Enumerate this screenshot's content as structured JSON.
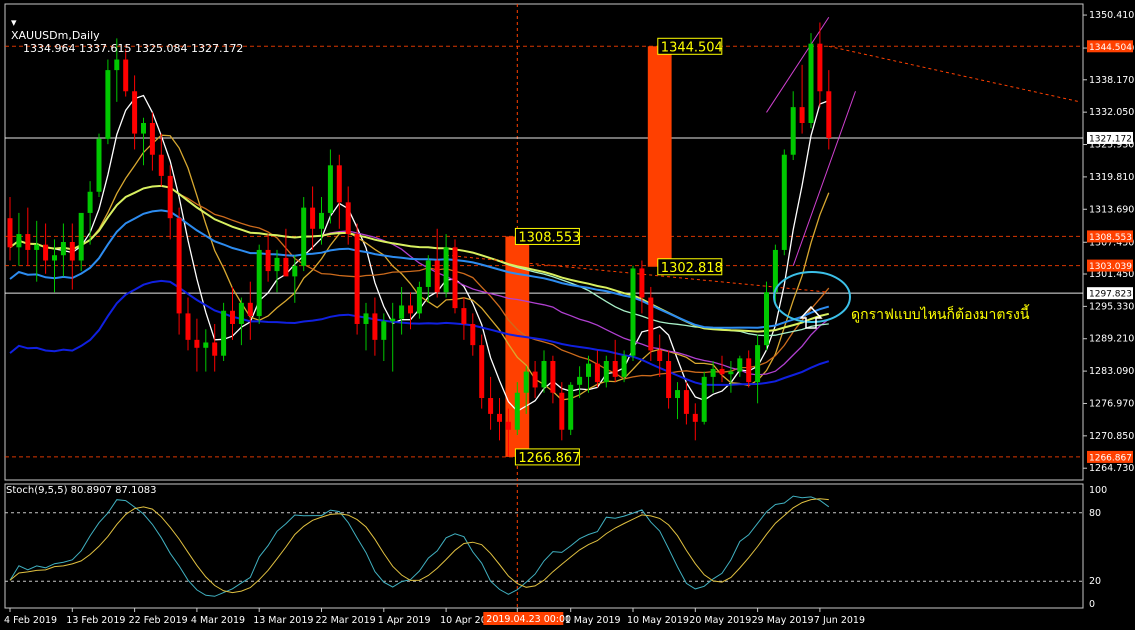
{
  "header": {
    "symbol": "XAUUSDm,Daily",
    "ohlc": "1334.964 1337.615 1325.084 1327.172"
  },
  "oscillator": {
    "label": "Stoch(9,5,5) 80.8907 87.1083",
    "levels": [
      0,
      20,
      80,
      100
    ],
    "level_labels": [
      "0",
      "20",
      "80",
      "100"
    ]
  },
  "annotation_text": "ดูกราฟแบบไหนก็ต้องมาตรงนี้",
  "colors": {
    "bull": "#00c800",
    "bear": "#ff0000",
    "highlight": "#ff4000",
    "text": "#ffffff",
    "label_bg_yellow": "#ffff00",
    "current_price_bg": "#ffffff",
    "ellipse": "#3cc0e8"
  },
  "chart_data": {
    "type": "candlestick",
    "price_range": [
      1262.5,
      1352.5
    ],
    "price_ticks": [
      1350.41,
      1344.17,
      1338.17,
      1332.05,
      1325.93,
      1319.81,
      1313.69,
      1307.45,
      1301.45,
      1295.33,
      1289.21,
      1283.09,
      1276.97,
      1270.85,
      1264.73
    ],
    "price_tick_labels": [
      "1350.410",
      "1344.170",
      "1338.170",
      "1332.050",
      "1325.930",
      "1319.810",
      "1313.690",
      "1307.450",
      "1301.450",
      "1295.330",
      "1289.210",
      "1283.090",
      "1276.970",
      "1270.850",
      "1264.730"
    ],
    "date_labels": [
      "4 Feb 2019",
      "13 Feb 2019",
      "22 Feb 2019",
      "4 Mar 2019",
      "13 Mar 2019",
      "22 Mar 2019",
      "1 Apr 2019",
      "10 Apr 2019",
      "2019.04.23 00:00",
      "1 May 2019",
      "10 May 2019",
      "20 May 2019",
      "29 May 2019",
      "7 Jun 2019"
    ],
    "date_label_index": [
      0,
      7,
      14,
      21,
      28,
      35,
      42,
      49,
      57,
      63,
      70,
      77,
      84,
      91
    ],
    "highlight_date_index": 57,
    "price_levels": [
      {
        "value": 1344.504,
        "label": "1344.504",
        "color": "#ff4000"
      },
      {
        "value": 1308.553,
        "label": "1308.553",
        "color": "#ff4000"
      },
      {
        "value": 1303.039,
        "label": "1303.039",
        "color": "#ff4000"
      },
      {
        "value": 1297.823,
        "label": "1297.823",
        "color": "#ffffff"
      },
      {
        "value": 1327.172,
        "label": "1327.172",
        "color": "#ffffff"
      },
      {
        "value": 1266.867,
        "label": "1266.867",
        "color": "#ff4000"
      }
    ],
    "boxes": [
      {
        "label": "1308.553",
        "index_from": 56,
        "index_to": 58,
        "high": 1308.553,
        "low": 1266.867,
        "label_at": "high"
      },
      {
        "label": "1266.867",
        "index_from": 56,
        "index_to": 58,
        "high": 1308.553,
        "low": 1266.867,
        "label_at": "low"
      },
      {
        "label": "1344.504",
        "index_from": 72,
        "index_to": 74,
        "high": 1344.504,
        "low": 1302.818,
        "label_at": "high"
      },
      {
        "label": "1302.818",
        "index_from": 72,
        "index_to": 74,
        "high": 1344.504,
        "low": 1302.818,
        "label_at": "low"
      }
    ],
    "candles": [
      [
        1312.0,
        1316.0,
        1304.0,
        1306.5
      ],
      [
        1306.5,
        1313.0,
        1303.0,
        1309.0
      ],
      [
        1309.0,
        1314.0,
        1303.0,
        1306.0
      ],
      [
        1306.0,
        1311.5,
        1300.0,
        1307.0
      ],
      [
        1307.0,
        1311.0,
        1301.5,
        1304.0
      ],
      [
        1304.0,
        1308.0,
        1298.0,
        1305.0
      ],
      [
        1305.0,
        1311.0,
        1301.0,
        1307.5
      ],
      [
        1307.5,
        1311.0,
        1298.5,
        1304.0
      ],
      [
        1304.0,
        1311.0,
        1302.0,
        1313.0
      ],
      [
        1313.0,
        1319.0,
        1307.0,
        1317.0
      ],
      [
        1317.0,
        1328.0,
        1316.0,
        1327.0
      ],
      [
        1327.0,
        1342.0,
        1326.0,
        1340.0
      ],
      [
        1340.0,
        1346.0,
        1334.0,
        1342.0
      ],
      [
        1342.0,
        1344.0,
        1335.0,
        1336.0
      ],
      [
        1336.0,
        1339.0,
        1325.0,
        1328.0
      ],
      [
        1328.0,
        1331.0,
        1322.0,
        1330.0
      ],
      [
        1330.0,
        1332.0,
        1321.0,
        1324.0
      ],
      [
        1324.0,
        1328.0,
        1318.0,
        1320.0
      ],
      [
        1320.0,
        1322.0,
        1308.0,
        1312.0
      ],
      [
        1312.0,
        1314.0,
        1290.0,
        1294.0
      ],
      [
        1294.0,
        1297.0,
        1287.0,
        1289.0
      ],
      [
        1289.0,
        1293.0,
        1283.0,
        1287.5
      ],
      [
        1287.5,
        1291.0,
        1283.0,
        1288.5
      ],
      [
        1288.5,
        1292.0,
        1283.0,
        1286.0
      ],
      [
        1286.0,
        1296.0,
        1285.0,
        1294.5
      ],
      [
        1294.5,
        1299.0,
        1289.0,
        1292.0
      ],
      [
        1292.0,
        1297.0,
        1288.0,
        1296.0
      ],
      [
        1296.0,
        1300.0,
        1289.0,
        1293.5
      ],
      [
        1293.5,
        1307.0,
        1292.0,
        1306.0
      ],
      [
        1306.0,
        1309.0,
        1300.0,
        1302.0
      ],
      [
        1302.0,
        1306.0,
        1298.0,
        1304.5
      ],
      [
        1304.5,
        1310.0,
        1302.0,
        1301.0
      ],
      [
        1301.0,
        1305.0,
        1296.0,
        1303.0
      ],
      [
        1303.0,
        1316.0,
        1302.0,
        1314.0
      ],
      [
        1314.0,
        1318.0,
        1306.0,
        1310.0
      ],
      [
        1310.0,
        1316.0,
        1307.0,
        1313.0
      ],
      [
        1313.0,
        1325.0,
        1311.0,
        1322.0
      ],
      [
        1322.0,
        1324.0,
        1310.0,
        1315.0
      ],
      [
        1315.0,
        1318.0,
        1307.0,
        1309.0
      ],
      [
        1309.0,
        1311.0,
        1290.0,
        1292.0
      ],
      [
        1292.0,
        1296.0,
        1287.0,
        1294.0
      ],
      [
        1294.0,
        1297.0,
        1286.0,
        1289.0
      ],
      [
        1289.0,
        1294.0,
        1285.0,
        1292.5
      ],
      [
        1292.5,
        1296.0,
        1283.0,
        1293.0
      ],
      [
        1293.0,
        1299.0,
        1290.0,
        1295.5
      ],
      [
        1295.5,
        1298.0,
        1291.0,
        1294.0
      ],
      [
        1294.0,
        1300.0,
        1293.0,
        1299.0
      ],
      [
        1299.0,
        1305.0,
        1296.0,
        1304.0
      ],
      [
        1304.0,
        1310.0,
        1297.0,
        1298.0
      ],
      [
        1298.0,
        1309.0,
        1297.0,
        1306.5
      ],
      [
        1306.5,
        1308.0,
        1294.0,
        1295.0
      ],
      [
        1295.0,
        1297.0,
        1289.0,
        1292.0
      ],
      [
        1292.0,
        1294.0,
        1286.0,
        1288.0
      ],
      [
        1288.0,
        1290.0,
        1276.0,
        1278.0
      ],
      [
        1278.0,
        1282.0,
        1272.0,
        1275.0
      ],
      [
        1275.0,
        1278.0,
        1270.0,
        1273.5
      ],
      [
        1273.5,
        1276.0,
        1267.0,
        1272.0
      ],
      [
        1272.0,
        1281.0,
        1271.0,
        1279.0
      ],
      [
        1279.0,
        1284.0,
        1275.0,
        1283.0
      ],
      [
        1283.0,
        1285.0,
        1278.0,
        1280.0
      ],
      [
        1280.0,
        1287.0,
        1279.0,
        1285.0
      ],
      [
        1285.0,
        1286.0,
        1277.0,
        1279.0
      ],
      [
        1279.0,
        1281.0,
        1270.0,
        1272.0
      ],
      [
        1272.0,
        1281.0,
        1271.0,
        1280.5
      ],
      [
        1280.5,
        1284.0,
        1278.0,
        1282.0
      ],
      [
        1282.0,
        1286.0,
        1279.0,
        1284.5
      ],
      [
        1284.5,
        1287.0,
        1280.0,
        1281.0
      ],
      [
        1281.0,
        1286.0,
        1280.0,
        1285.0
      ],
      [
        1285.0,
        1289.0,
        1281.0,
        1282.0
      ],
      [
        1282.0,
        1287.0,
        1281.0,
        1286.0
      ],
      [
        1286.0,
        1303.0,
        1285.0,
        1302.5
      ],
      [
        1302.5,
        1304.0,
        1294.0,
        1297.0
      ],
      [
        1297.0,
        1299.0,
        1285.0,
        1287.0
      ],
      [
        1287.0,
        1290.0,
        1282.0,
        1285.0
      ],
      [
        1285.0,
        1287.0,
        1276.0,
        1278.0
      ],
      [
        1278.0,
        1281.0,
        1274.0,
        1279.5
      ],
      [
        1279.5,
        1281.0,
        1273.0,
        1275.0
      ],
      [
        1275.0,
        1277.0,
        1270.0,
        1273.5
      ],
      [
        1273.5,
        1283.0,
        1273.0,
        1282.0
      ],
      [
        1282.0,
        1285.0,
        1279.0,
        1283.5
      ],
      [
        1283.5,
        1286.0,
        1281.0,
        1282.5
      ],
      [
        1282.5,
        1285.0,
        1279.0,
        1283.0
      ],
      [
        1283.0,
        1286.0,
        1282.0,
        1285.5
      ],
      [
        1285.5,
        1287.0,
        1280.0,
        1281.0
      ],
      [
        1281.0,
        1290.0,
        1277.0,
        1288.0
      ],
      [
        1288.0,
        1300.0,
        1287.0,
        1298.0
      ],
      [
        1298.0,
        1307.0,
        1296.0,
        1306.0
      ],
      [
        1306.0,
        1325.0,
        1305.0,
        1324.0
      ],
      [
        1324.0,
        1336.0,
        1323.0,
        1333.0
      ],
      [
        1333.0,
        1341.0,
        1328.0,
        1330.0
      ],
      [
        1330.0,
        1347.0,
        1329.0,
        1345.0
      ],
      [
        1345.0,
        1349.0,
        1333.0,
        1336.0
      ],
      [
        1336.0,
        1340.0,
        1325.0,
        1327.172
      ]
    ],
    "moving_averages": [
      {
        "period": 5,
        "color": "#ffffff"
      },
      {
        "period": 10,
        "color": "#d8a830"
      },
      {
        "period": 20,
        "color": "#cd6b1c"
      },
      {
        "period": 34,
        "color": "#b040d0"
      },
      {
        "period": 55,
        "color": "#a8f0c8"
      },
      {
        "period": 89,
        "color": "#d8f060"
      },
      {
        "period": 144,
        "color": "#2d8cf0"
      },
      {
        "period": 200,
        "color": "#1020e0"
      }
    ],
    "oscillator_series": [
      {
        "name": "main",
        "color": "#40b0c0"
      },
      {
        "name": "signal",
        "color": "#e0c040"
      }
    ]
  }
}
